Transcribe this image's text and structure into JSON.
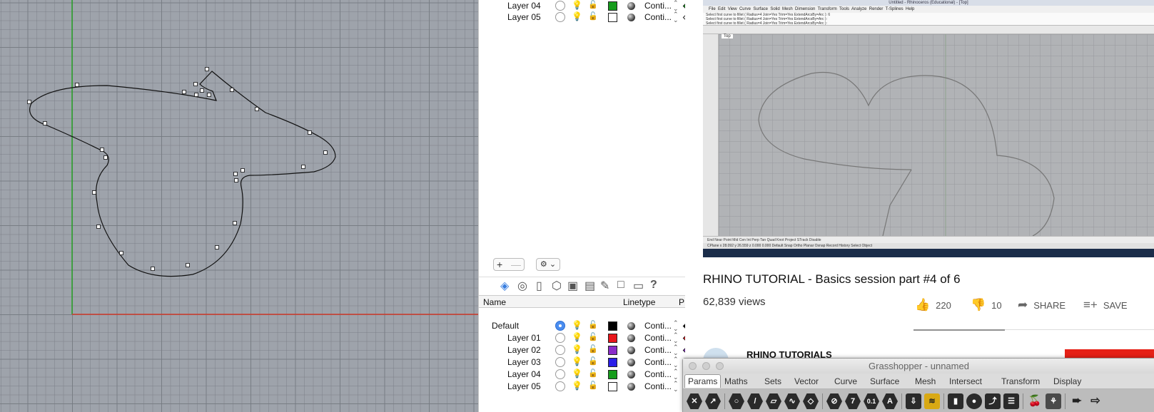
{
  "layers_top": [
    {
      "name": "Layer 04",
      "color": "#169c1c",
      "print": "#169c1c",
      "linetype": "Conti..."
    },
    {
      "name": "Layer 05",
      "color": "#ffffff",
      "print": "#ffffff",
      "linetype": "Conti..."
    }
  ],
  "layers_panel": {
    "add_label": "+",
    "remove_label": "—",
    "gear_label": "⚙ ⌄",
    "columns": {
      "name": "Name",
      "linetype": "Linetype",
      "print": "P"
    },
    "rows": [
      {
        "name": "Default",
        "current": true,
        "color": "#000000",
        "print": "#000000",
        "linetype": "Conti..."
      },
      {
        "name": "Layer 01",
        "current": false,
        "color": "#e8161b",
        "print": "#e8161b",
        "linetype": "Conti..."
      },
      {
        "name": "Layer 02",
        "current": false,
        "color": "#8a2cc9",
        "print": "#8a2cc9",
        "linetype": "Conti..."
      },
      {
        "name": "Layer 03",
        "current": false,
        "color": "#2a1ee8",
        "print": "#2a1ee8",
        "linetype": "Conti..."
      },
      {
        "name": "Layer 04",
        "current": false,
        "color": "#169c1c",
        "print": "#169c1c",
        "linetype": "Conti..."
      },
      {
        "name": "Layer 05",
        "current": false,
        "color": "#ffffff",
        "print": "#ffffff",
        "linetype": "Conti..."
      }
    ]
  },
  "video_screen": {
    "title_bar": "Untitled - Rhinoceros (Educational) - [Top]",
    "menu": [
      "File",
      "Edit",
      "View",
      "Curve",
      "Surface",
      "Solid",
      "Mesh",
      "Dimension",
      "Transform",
      "Tools",
      "Analyze",
      "Render",
      "T-Splines",
      "Help"
    ],
    "command_lines": [
      "Select first curve to fillet ( Radius=4 Join=Yes Trim=Yes ExtendArcsBy=Arc ): 6",
      "Select first curve to fillet ( Radius=4 Join=Yes Trim=Yes ExtendArcsBy=Arc ):",
      "Select first curve to fillet ( Radius=4 Join=Yes Trim=Yes ExtendArcsBy=Arc ):"
    ],
    "viewport_label": "Top",
    "osnaps": "End  Near  Point  Mid  Cen  Int  Perp  Tan  Quad  Knot  Project  STrack  Disable",
    "status": "CPlane  x 28.092   y 26.559   z 0.000   0.000   Default   Snap  Ortho  Planar  Osnap  Record History  Select Object"
  },
  "video": {
    "title": "RHINO TUTORIAL - Basics session part #4 of 6",
    "views": "62,839 views",
    "likes": "220",
    "dislikes": "10",
    "share": "SHARE",
    "save": "SAVE",
    "channel": "RHINO TUTORIALS"
  },
  "grasshopper": {
    "title": "Grasshopper - unnamed",
    "tabs": [
      "Params",
      "Maths",
      "Sets",
      "Vector",
      "Curve",
      "Surface",
      "Mesh",
      "Intersect",
      "Transform",
      "Display"
    ],
    "active_tab": "Params",
    "number_icons": [
      "7",
      "0.1",
      "A"
    ]
  }
}
